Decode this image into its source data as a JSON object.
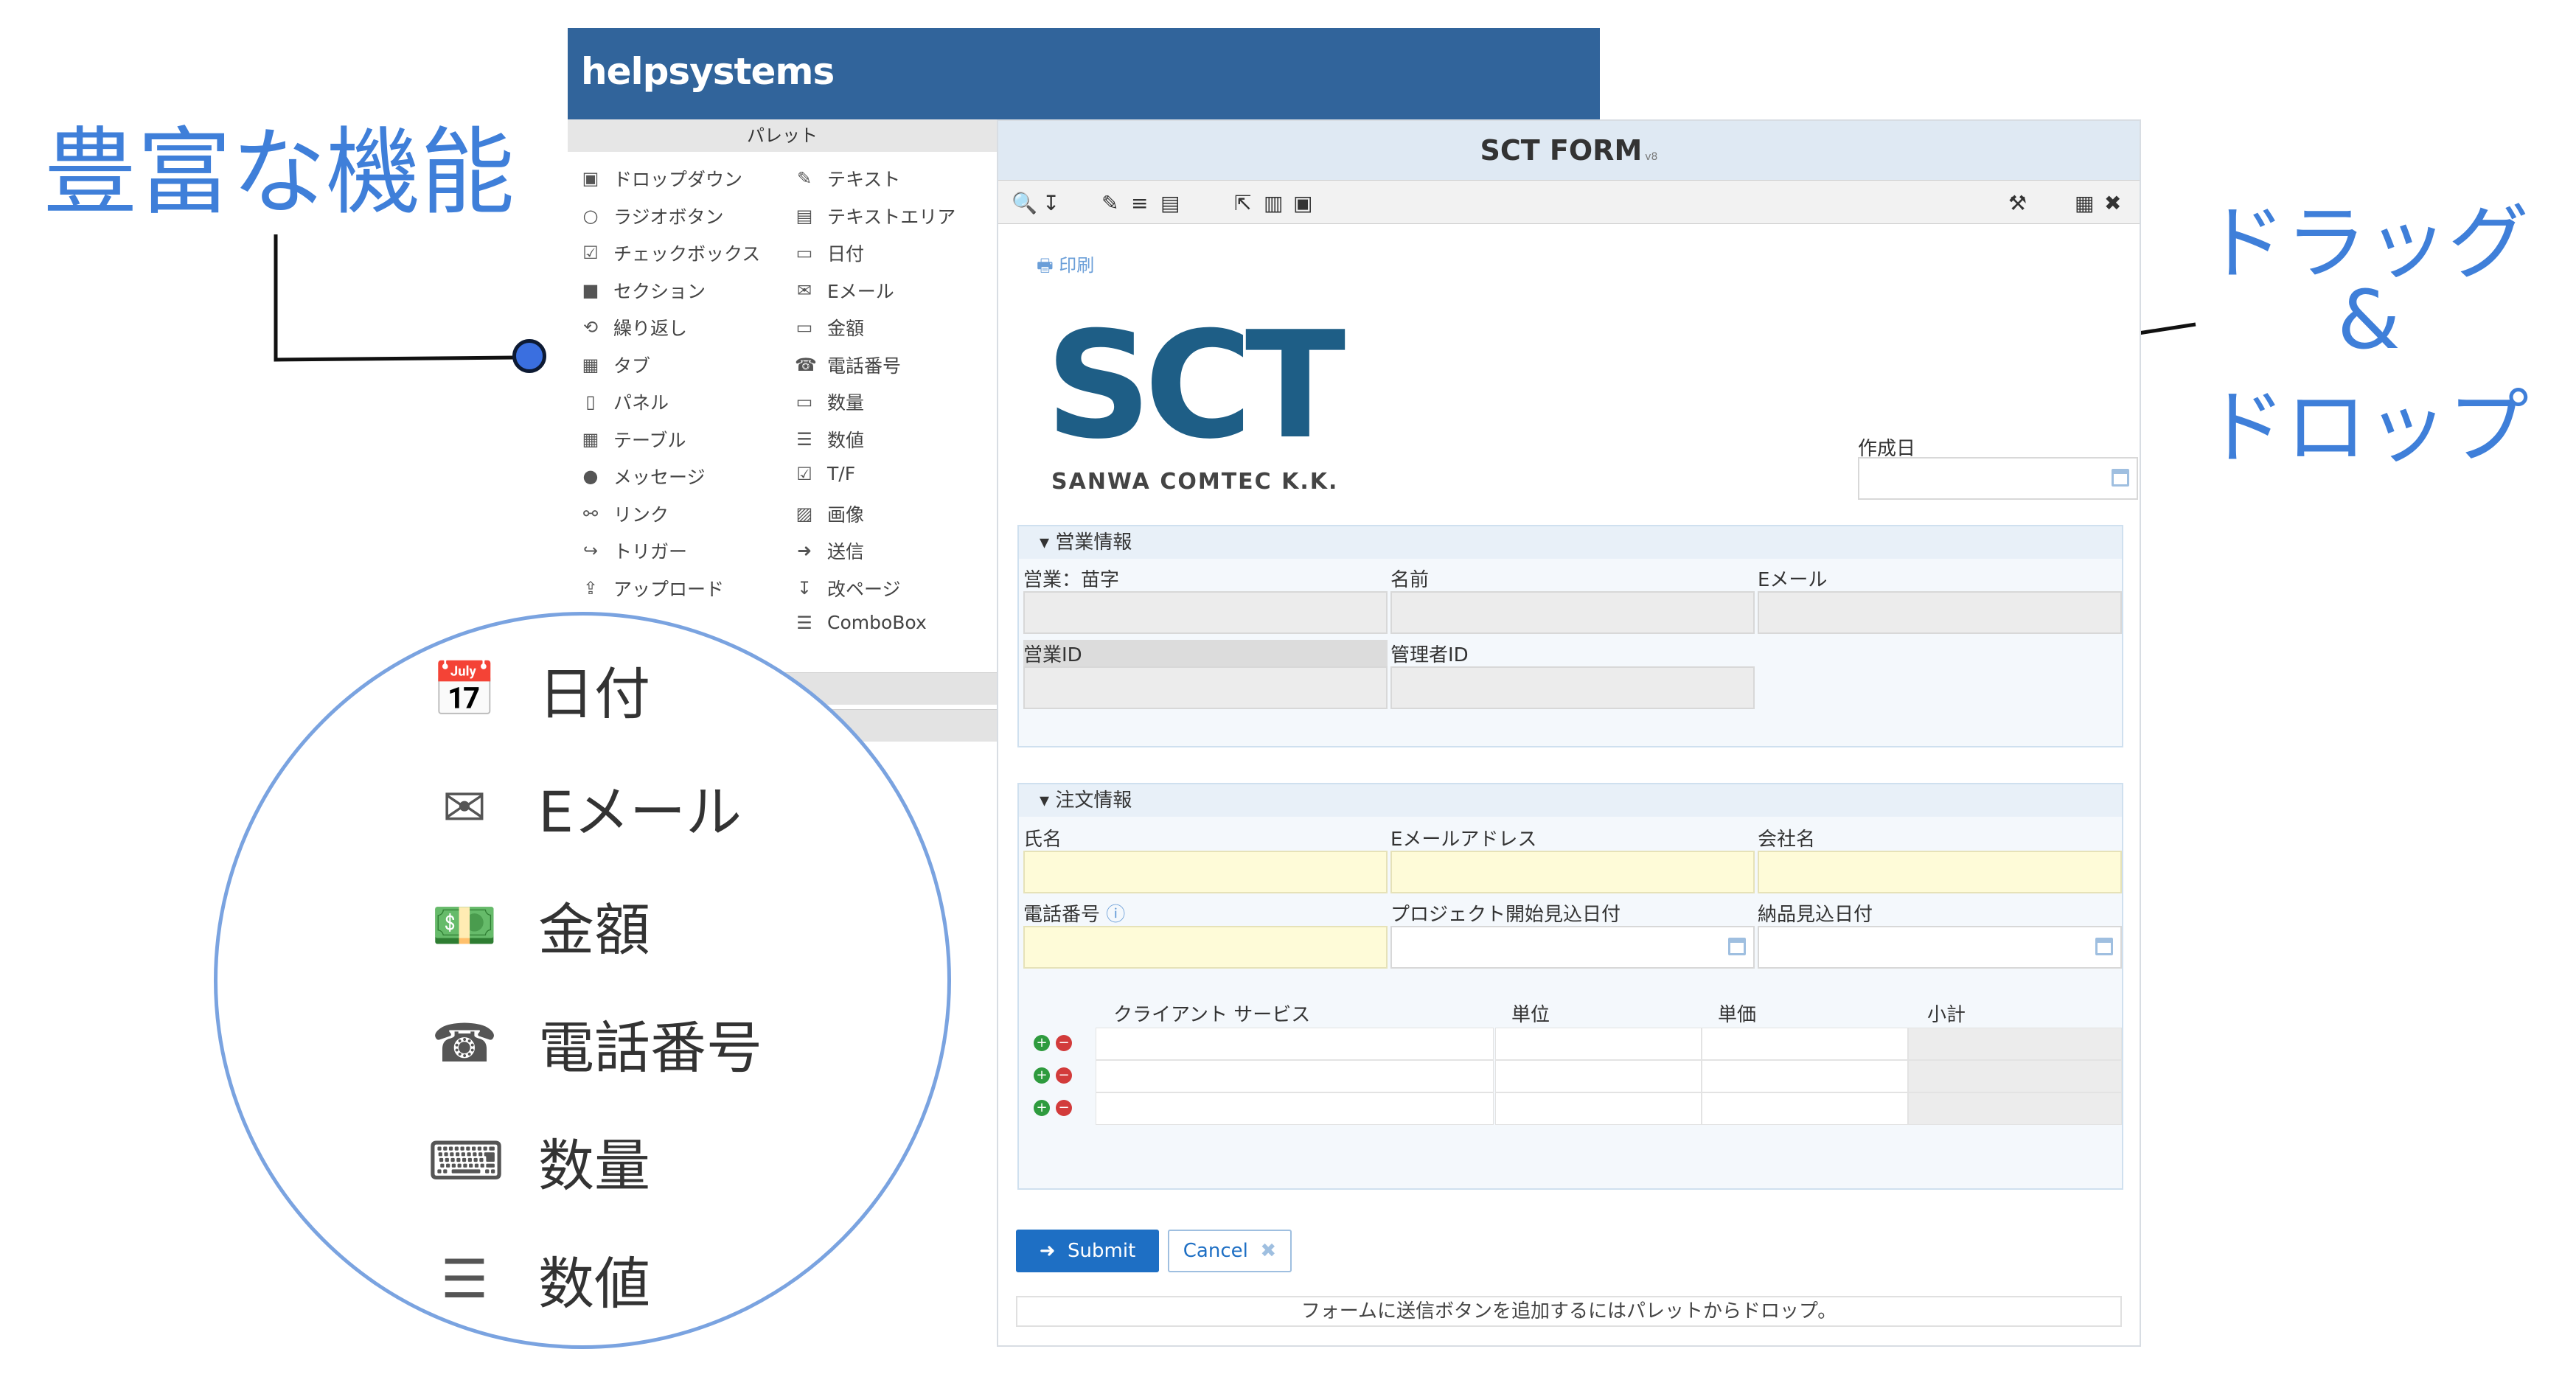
{
  "annotations": {
    "features_label": "豊富な機能",
    "dragdrop_line1": "ドラッグ",
    "dragdrop_line2": "&",
    "dragdrop_line3": "ドロップ"
  },
  "brand": {
    "logo_text": "helpsystems"
  },
  "palette": {
    "title": "パレット",
    "left_items": [
      "ドロップダウン",
      "ラジオボタン",
      "チェックボックス",
      "セクション",
      "繰り返し",
      "タブ",
      "パネル",
      "テーブル",
      "メッセージ",
      "リンク",
      "トリガー",
      "アップロード"
    ],
    "right_items": [
      "テキスト",
      "テキストエリア",
      "日付",
      "Eメール",
      "金額",
      "電話番号",
      "数量",
      "数値",
      "T/F",
      "画像",
      "送信",
      "改ページ",
      "ComboBox"
    ],
    "left_icons": [
      "dropdown-icon",
      "radio-icon",
      "checkbox-icon",
      "folder-icon",
      "repeat-icon",
      "grid-icon",
      "panel-icon",
      "table-icon",
      "chat-icon",
      "link-icon",
      "trigger-icon",
      "upload-icon"
    ],
    "right_icons": [
      "pencil-icon",
      "textarea-icon",
      "calendar-icon",
      "envelope-icon",
      "money-icon",
      "phone-icon",
      "keyboard-icon",
      "list-numbered-icon",
      "check-square-icon",
      "image-icon",
      "send-icon",
      "page-break-icon",
      "combobox-icon"
    ]
  },
  "form": {
    "title": "SCT FORM",
    "version": "v8",
    "print_label": "印刷",
    "company_logo": "SCT",
    "company_name": "SANWA COMTEC K.K.",
    "created_date_label": "作成日",
    "sales_section": {
      "title": "営業情報",
      "labels": [
        "営業：苗字",
        "名前",
        "Eメール",
        "営業ID",
        "管理者ID"
      ]
    },
    "order_section": {
      "title": "注文情報",
      "labels": [
        "氏名",
        "Eメールアドレス",
        "会社名",
        "電話番号",
        "プロジェクト開始見込日付",
        "納品見込日付"
      ],
      "table_headers": [
        "クライアント サービス",
        "単位",
        "単価",
        "小計"
      ]
    },
    "submit_label": "Submit",
    "cancel_label": "Cancel",
    "footer_hint": "フォームに送信ボタンを追加するにはパレットからドロップ。"
  },
  "zoom": {
    "items": [
      "日付",
      "Eメール",
      "金額",
      "電話番号",
      "数量",
      "数値"
    ],
    "icons": [
      "calendar-icon",
      "envelope-icon",
      "money-icon",
      "phone-icon",
      "keyboard-icon",
      "list-numbered-icon"
    ]
  },
  "colors": {
    "brand": "#31649b",
    "accent": "#3f7fd9",
    "submit": "#1e6fc4"
  }
}
